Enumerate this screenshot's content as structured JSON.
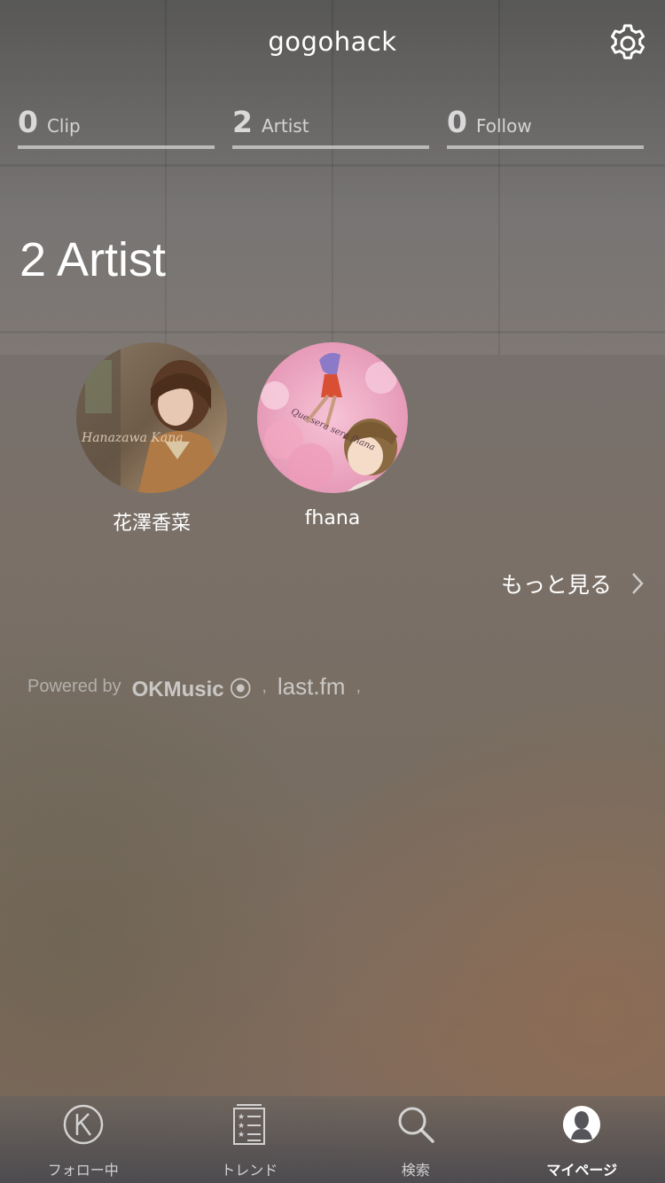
{
  "header": {
    "title": "gogohack",
    "settings_icon": "gear-icon"
  },
  "stats": [
    {
      "count": "0",
      "label": "Clip"
    },
    {
      "count": "2",
      "label": "Artist"
    },
    {
      "count": "0",
      "label": "Follow"
    }
  ],
  "section": {
    "title": "2 Artist"
  },
  "artists": [
    {
      "name": "花澤香菜",
      "cover_text": "Hanazawa Kana"
    },
    {
      "name": "fhana",
      "cover_text": "Que sera sera fhana"
    }
  ],
  "more": {
    "label": "もっと見る",
    "icon": "chevron-right-icon"
  },
  "powered_by": {
    "label": "Powered by",
    "brands": [
      "OKMusic",
      "last.fm"
    ],
    "separator": ","
  },
  "tabs": [
    {
      "label": "フォロー中",
      "icon": "k-circle-icon",
      "active": false
    },
    {
      "label": "トレンド",
      "icon": "ranking-list-icon",
      "active": false
    },
    {
      "label": "検索",
      "icon": "search-icon",
      "active": false
    },
    {
      "label": "マイページ",
      "icon": "profile-icon",
      "active": true
    }
  ],
  "colors": {
    "text": "#ffffff",
    "stat_underline": "#dcdcdc",
    "tabbar": "#48484e"
  }
}
